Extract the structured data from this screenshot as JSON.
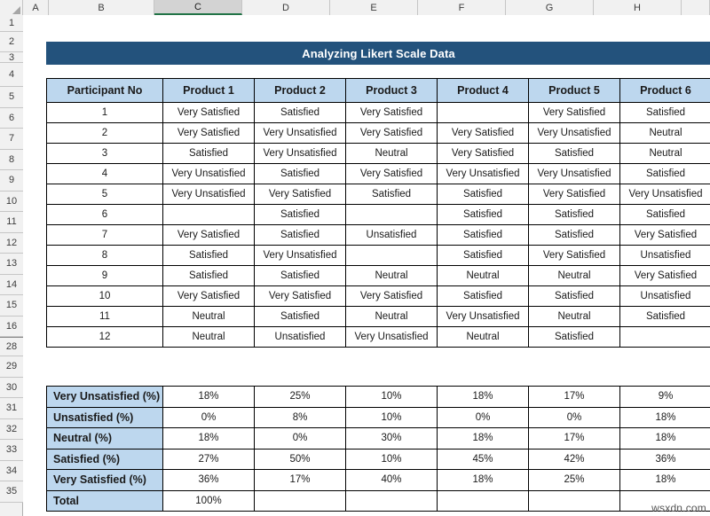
{
  "spreadsheet": {
    "column_headers": [
      "A",
      "B",
      "C",
      "D",
      "E",
      "F",
      "G",
      "H"
    ],
    "selected_column": "C",
    "row_headers": [
      "1",
      "2",
      "3",
      "4",
      "5",
      "6",
      "7",
      "8",
      "9",
      "10",
      "11",
      "12",
      "13",
      "14",
      "15",
      "16",
      "28",
      "29",
      "30",
      "31",
      "32",
      "33",
      "34",
      "35"
    ],
    "watermark": "wsxdn.com",
    "colors": {
      "title_banner_bg": "#23527c",
      "title_banner_text": "#ffffff",
      "header_cell_bg": "#bdd7ee",
      "grid_line": "#000000",
      "sheet_bg": "#ffffff",
      "selected_column_bg": "#d3d3d3",
      "selected_column_underline": "#217346"
    }
  },
  "title": "Analyzing Likert Scale Data",
  "main_table": {
    "headers": [
      "Participant No",
      "Product 1",
      "Product 2",
      "Product 3",
      "Product 4",
      "Product 5",
      "Product 6"
    ],
    "rows": [
      [
        "1",
        "Very Satisfied",
        "Satisfied",
        "Very Satisfied",
        "",
        "Very Satisfied",
        "Satisfied"
      ],
      [
        "2",
        "Very Satisfied",
        "Very Unsatisfied",
        "Very Satisfied",
        "Very Satisfied",
        "Very Unsatisfied",
        "Neutral"
      ],
      [
        "3",
        "Satisfied",
        "Very Unsatisfied",
        "Neutral",
        "Very Satisfied",
        "Satisfied",
        "Neutral"
      ],
      [
        "4",
        "Very Unsatisfied",
        "Satisfied",
        "Very Satisfied",
        "Very Unsatisfied",
        "Very Unsatisfied",
        "Satisfied"
      ],
      [
        "5",
        "Very Unsatisfied",
        "Very Satisfied",
        "Satisfied",
        "Satisfied",
        "Very Satisfied",
        "Very Unsatisfied"
      ],
      [
        "6",
        "",
        "Satisfied",
        "",
        "Satisfied",
        "Satisfied",
        "Satisfied"
      ],
      [
        "7",
        "Very Satisfied",
        "Satisfied",
        "Unsatisfied",
        "Satisfied",
        "Satisfied",
        "Very Satisfied"
      ],
      [
        "8",
        "Satisfied",
        "Very Unsatisfied",
        "",
        "Satisfied",
        "Very Satisfied",
        "Unsatisfied"
      ],
      [
        "9",
        "Satisfied",
        "Satisfied",
        "Neutral",
        "Neutral",
        "Neutral",
        "Very Satisfied"
      ],
      [
        "10",
        "Very Satisfied",
        "Very Satisfied",
        "Very Satisfied",
        "Satisfied",
        "Satisfied",
        "Unsatisfied"
      ],
      [
        "11",
        "Neutral",
        "Satisfied",
        "Neutral",
        "Very Unsatisfied",
        "Neutral",
        "Satisfied"
      ],
      [
        "12",
        "Neutral",
        "Unsatisfied",
        "Very Unsatisfied",
        "Neutral",
        "Satisfied",
        ""
      ]
    ]
  },
  "summary_table": {
    "rows": [
      [
        "Very Unsatisfied (%)",
        "18%",
        "25%",
        "10%",
        "18%",
        "17%",
        "9%"
      ],
      [
        "Unsatisfied (%)",
        "0%",
        "8%",
        "10%",
        "0%",
        "0%",
        "18%"
      ],
      [
        "Neutral (%)",
        "18%",
        "0%",
        "30%",
        "18%",
        "17%",
        "18%"
      ],
      [
        "Satisfied (%)",
        "27%",
        "50%",
        "10%",
        "45%",
        "42%",
        "36%"
      ],
      [
        "Very Satisfied (%)",
        "36%",
        "17%",
        "40%",
        "18%",
        "25%",
        "18%"
      ],
      [
        "Total",
        "100%",
        "",
        "",
        "",
        "",
        ""
      ]
    ]
  }
}
